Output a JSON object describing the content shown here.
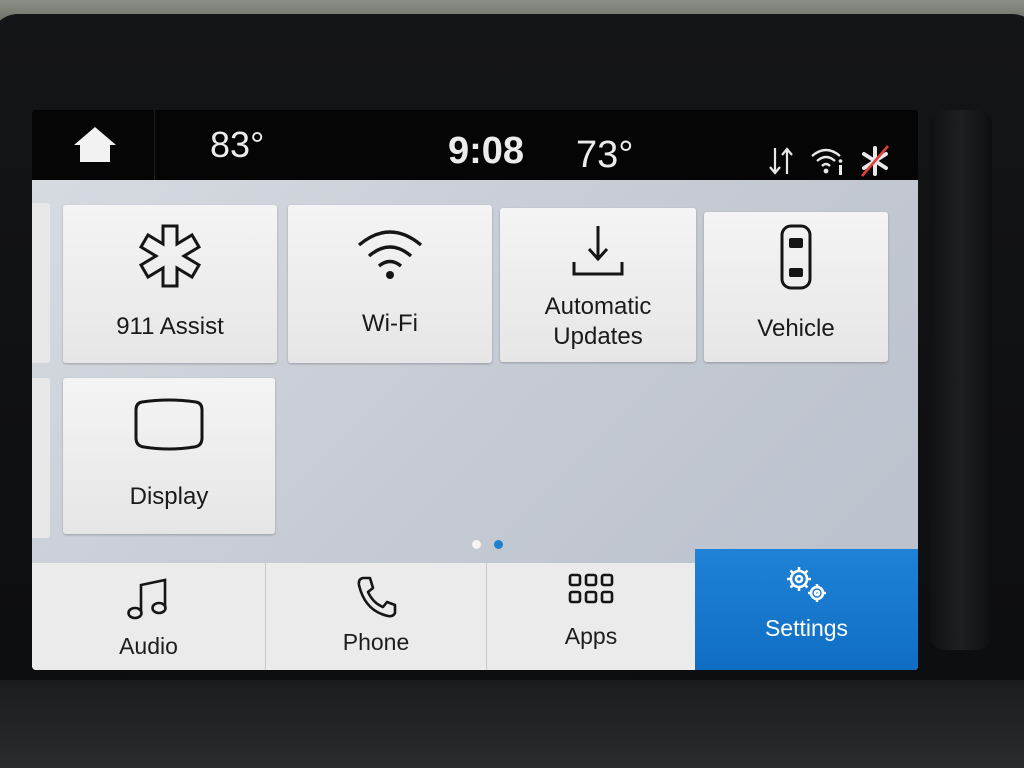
{
  "status_bar": {
    "outside_temp": "83°",
    "time": "9:08",
    "cabin_temp": "73°",
    "icons": [
      "home-icon",
      "data-transfer-icon",
      "wifi-info-icon",
      "911-assist-off-icon"
    ]
  },
  "settings_grid": {
    "tiles": [
      {
        "label": "911 Assist",
        "icon": "star-of-life-icon"
      },
      {
        "label": "Wi-Fi",
        "icon": "wifi-icon"
      },
      {
        "label": "Automatic Updates",
        "line1": "Automatic",
        "line2": "Updates",
        "icon": "download-icon"
      },
      {
        "label": "Vehicle",
        "icon": "car-icon"
      },
      {
        "label": "Display",
        "icon": "display-icon"
      }
    ],
    "page_indicator": {
      "total": 2,
      "current": 2
    }
  },
  "nav_bar": {
    "items": [
      {
        "label": "Audio",
        "icon": "music-note-icon",
        "active": false
      },
      {
        "label": "Phone",
        "icon": "phone-icon",
        "active": false
      },
      {
        "label": "Apps",
        "icon": "grid-icon",
        "active": false
      },
      {
        "label": "Settings",
        "icon": "gears-icon",
        "active": true
      }
    ]
  },
  "colors": {
    "accent": "#1f7fd1",
    "status_bar_bg": "#050505",
    "tile_bg": "#f0f0f0",
    "panel_bg": "#c9ced6"
  }
}
